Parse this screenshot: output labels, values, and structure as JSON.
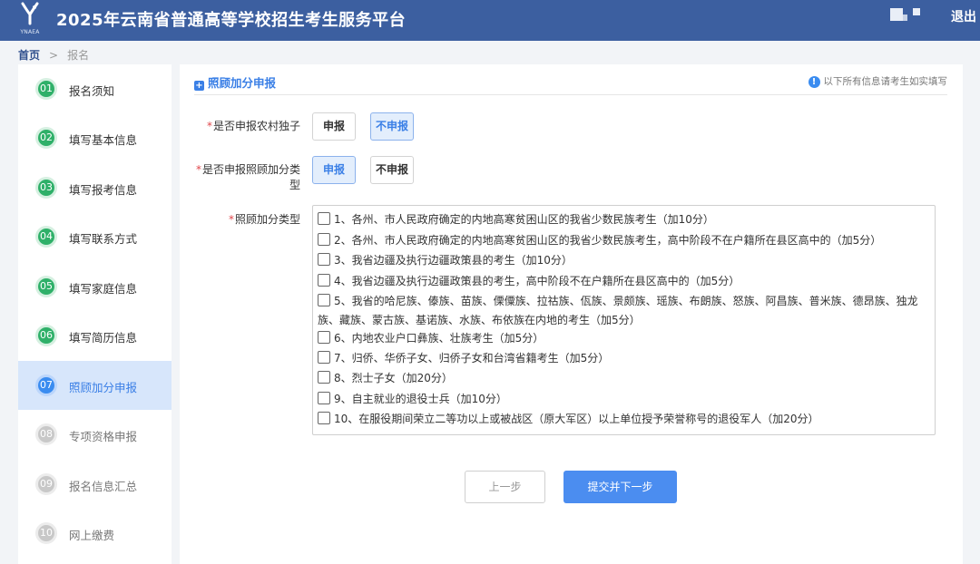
{
  "header": {
    "logo_text": "YNAEA",
    "title": "2025年云南省普通高等学校招生考生服务平台",
    "logout_label": "退出"
  },
  "breadcrumb": {
    "home": "首页",
    "separator": ">",
    "current": "报名"
  },
  "sidebar": {
    "steps": [
      {
        "num": "01",
        "label": "报名须知",
        "state": "done"
      },
      {
        "num": "02",
        "label": "填写基本信息",
        "state": "done"
      },
      {
        "num": "03",
        "label": "填写报考信息",
        "state": "done"
      },
      {
        "num": "04",
        "label": "填写联系方式",
        "state": "done"
      },
      {
        "num": "05",
        "label": "填写家庭信息",
        "state": "done"
      },
      {
        "num": "06",
        "label": "填写简历信息",
        "state": "done"
      },
      {
        "num": "07",
        "label": "照顾加分申报",
        "state": "active"
      },
      {
        "num": "08",
        "label": "专项资格申报",
        "state": "todo"
      },
      {
        "num": "09",
        "label": "报名信息汇总",
        "state": "todo"
      },
      {
        "num": "10",
        "label": "网上缴费",
        "state": "todo"
      }
    ]
  },
  "panel": {
    "title": "照顾加分申报",
    "notice": "以下所有信息请考生如实填写",
    "q1": {
      "label": "是否申报农村独子",
      "options": [
        "申报",
        "不申报"
      ],
      "selected": "不申报"
    },
    "q2": {
      "label_line1": "是否申报照顾加分类",
      "label_line2": "型",
      "options": [
        "申报",
        "不申报"
      ],
      "selected": "申报"
    },
    "q3": {
      "label": "照顾加分类型",
      "items": [
        "1、各州、市人民政府确定的内地高寒贫困山区的我省少数民族考生（加10分）",
        "2、各州、市人民政府确定的内地高寒贫困山区的我省少数民族考生，高中阶段不在户籍所在县区高中的（加5分）",
        "3、我省边疆及执行边疆政策县的考生（加10分）",
        "4、我省边疆及执行边疆政策县的考生，高中阶段不在户籍所在县区高中的（加5分）",
        "5、我省的哈尼族、傣族、苗族、傈僳族、拉祜族、佤族、景颇族、瑶族、布朗族、怒族、阿昌族、普米族、德昂族、独龙族、藏族、蒙古族、基诺族、水族、布依族在内地的考生（加5分）",
        "6、内地农业户口彝族、壮族考生（加5分）",
        "7、归侨、华侨子女、归侨子女和台湾省籍考生（加5分）",
        "8、烈士子女（加20分）",
        "9、自主就业的退役士兵（加10分）",
        "10、在服役期间荣立二等功以上或被战区（原大军区）以上单位授予荣誉称号的退役军人（加20分）"
      ],
      "checked": [
        false,
        false,
        false,
        false,
        false,
        false,
        false,
        false,
        false,
        false
      ]
    },
    "prev_label": "上一步",
    "next_label": "提交并下一步"
  },
  "colors": {
    "header_bg": "#3c5fa0",
    "accent": "#3a7fe6",
    "done": "#2fb069",
    "required": "#e0474c"
  }
}
